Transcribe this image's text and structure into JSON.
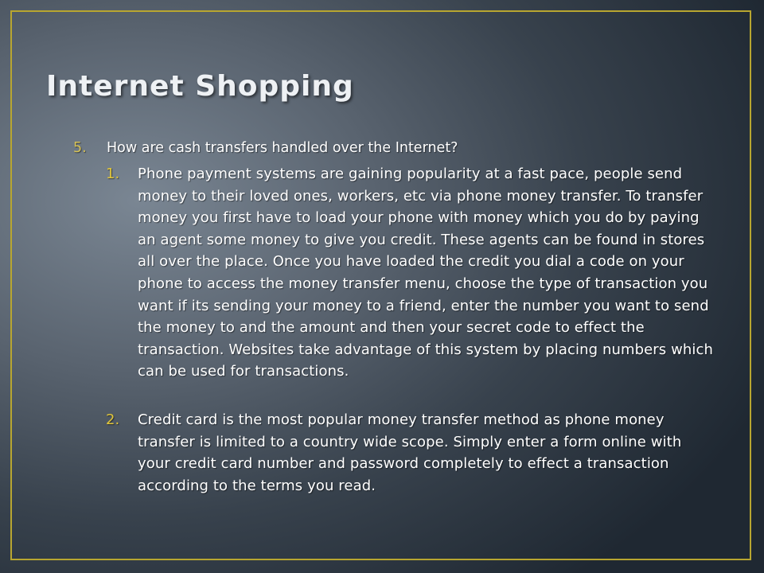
{
  "slide": {
    "title": "Internet Shopping",
    "question": {
      "number": "5.",
      "text": "How are cash transfers handled over the Internet?"
    },
    "items": [
      {
        "number": "1.",
        "text": "Phone payment systems are gaining popularity at a fast pace, people send money to their loved ones, workers, etc via phone money transfer. To transfer money you first have to load your phone with money which you do by paying an agent some money to give you credit. These agents can be found in stores all over the place. Once you have loaded the credit you dial a code on your phone to access the money transfer menu, choose the type of transaction you want if its sending your money to a friend, enter the number you want to send the money to and the amount and then your secret code to effect the transaction. Websites take advantage of this system by placing numbers which can be used for transactions."
      },
      {
        "number": "2.",
        "text": "Credit card is the most popular money transfer method as phone money transfer is limited to a country wide scope. Simply enter a form online with your credit card number and password completely to effect a transaction according to the terms you read."
      }
    ]
  },
  "colors": {
    "frame_border": "#b8a630",
    "number_accent": "#e0c53a",
    "text": "#ffffff"
  }
}
